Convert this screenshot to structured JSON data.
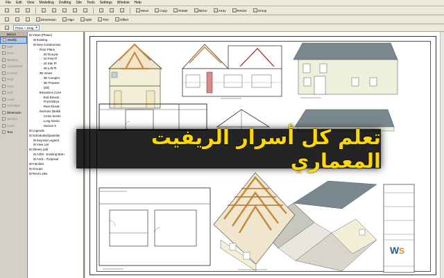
{
  "menu": [
    "File",
    "Edit",
    "View",
    "Modelling",
    "Drafting",
    "Site",
    "Tools",
    "Settings",
    "Window",
    "Help"
  ],
  "toolbar1": {
    "buttons": [
      "Move",
      "Copy",
      "Rotate",
      "Mirror",
      "Array",
      "Resize",
      "Group"
    ]
  },
  "toolbar2": {
    "buttons": [
      "Dimension",
      "Align",
      "Split",
      "Trim",
      "Offset"
    ]
  },
  "toolbar3": {
    "dropdown": "Press + Drag"
  },
  "design_bar": {
    "tab": "Basics",
    "items": [
      {
        "label": "Modify",
        "state": "active"
      },
      {
        "label": "Wall",
        "state": "dim"
      },
      {
        "label": "Door",
        "state": "dim"
      },
      {
        "label": "Window",
        "state": "dim"
      },
      {
        "label": "Component",
        "state": "dim"
      },
      {
        "label": "Column",
        "state": "dim"
      },
      {
        "label": "Roof",
        "state": "dim"
      },
      {
        "label": "Floor",
        "state": "dim"
      },
      {
        "label": "Grid",
        "state": "dim"
      },
      {
        "label": "Level",
        "state": "dim"
      },
      {
        "label": "Ref Plane",
        "state": "dim"
      },
      {
        "label": "Dimension",
        "state": "normal"
      },
      {
        "label": "Section",
        "state": "dim"
      },
      {
        "label": "Level",
        "state": "dim"
      },
      {
        "label": "Text",
        "state": "normal"
      }
    ]
  },
  "browser": {
    "header": "",
    "nodes": [
      {
        "label": "Views (Phase)",
        "indent": 0
      },
      {
        "label": "Existing",
        "indent": 1
      },
      {
        "label": "New Construction",
        "indent": 1
      },
      {
        "label": "Floor Plans",
        "indent": 2
      },
      {
        "label": "20 Ground",
        "indent": 3
      },
      {
        "label": "22 First Fl",
        "indent": 3
      },
      {
        "label": "24 Site Pl",
        "indent": 3
      },
      {
        "label": "26 Loft Pl",
        "indent": 3
      },
      {
        "label": "3D Views",
        "indent": 2
      },
      {
        "label": "3D Complet",
        "indent": 3
      },
      {
        "label": "3D Propose",
        "indent": 3
      },
      {
        "label": "{3D}",
        "indent": 3
      },
      {
        "label": "Elevations (12m",
        "indent": 2
      },
      {
        "label": "End Elevati",
        "indent": 3
      },
      {
        "label": "Front Eleva",
        "indent": 3
      },
      {
        "label": "Rear Elevat",
        "indent": 3
      },
      {
        "label": "Sections (Buildi",
        "indent": 2
      },
      {
        "label": "Cross Sectio",
        "indent": 3
      },
      {
        "label": "Long Sectio",
        "indent": 3
      },
      {
        "label": "Section 5",
        "indent": 3
      },
      {
        "label": "Legends",
        "indent": 0
      },
      {
        "label": "Schedules/Quantitie",
        "indent": 0
      },
      {
        "label": "Keynote Legend",
        "indent": 1
      },
      {
        "label": "View List",
        "indent": 1
      },
      {
        "label": "Sheets (all)",
        "indent": 0
      },
      {
        "label": "A100 - Existing Barn",
        "indent": 1
      },
      {
        "label": "A101 - Proposal",
        "indent": 1
      },
      {
        "label": "Families",
        "indent": 0
      },
      {
        "label": "Groups",
        "indent": 0
      },
      {
        "label": "Revit Links",
        "indent": 0
      }
    ]
  },
  "banner": {
    "text": "تعلم كل أسرار الريفيت المعماري"
  },
  "colors": {
    "banner_text": "#ffd800",
    "banner_bg": "#000000",
    "timber": "#c88a3a",
    "wall": "#f3efd7",
    "roof": "#79888f"
  }
}
